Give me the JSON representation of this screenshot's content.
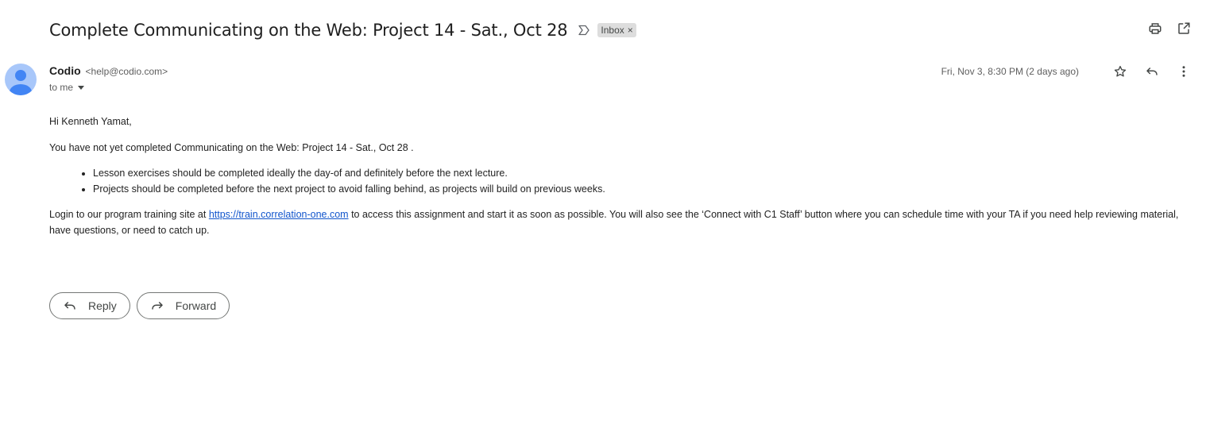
{
  "message": {
    "subject": "Complete Communicating on the Web: Project 14 - Sat., Oct 28",
    "label": "Inbox",
    "label_close": "×",
    "sender_name": "Codio",
    "sender_email": "<help@codio.com>",
    "recipients": "to me",
    "date": "Fri, Nov 3, 8:30 PM (2 days ago)"
  },
  "body": {
    "greeting": "Hi Kenneth Yamat,",
    "notice": "You have not yet completed Communicating on the Web: Project 14 - Sat., Oct 28 .",
    "bullets": [
      "Lesson exercises should be completed ideally the day-of and definitely before the next lecture.",
      "Projects should be completed before the next project to avoid falling behind, as projects will build on previous weeks."
    ],
    "login_prefix": "Login to our program training site at ",
    "login_link": "https://train.correlation-one.com",
    "login_suffix": " to access this assignment and start it as soon as possible. You will also see the ‘Connect with C1 Staff’ button where you can schedule time with your TA if you need help reviewing material, have questions, or need to catch up."
  },
  "actions": {
    "reply_label": "Reply",
    "forward_label": "Forward"
  },
  "icons": {
    "importance": "importance-marker-icon",
    "print": "print-icon",
    "open_new_window": "open-in-new-window-icon",
    "star": "star-icon",
    "reply": "reply-icon",
    "more": "more-vertical-icon",
    "forward": "forward-icon"
  },
  "colors": {
    "link": "#1155cc",
    "avatar_bg": "#a8c7fa",
    "avatar_fg": "#4285f4",
    "chip_bg": "#dddddd"
  }
}
